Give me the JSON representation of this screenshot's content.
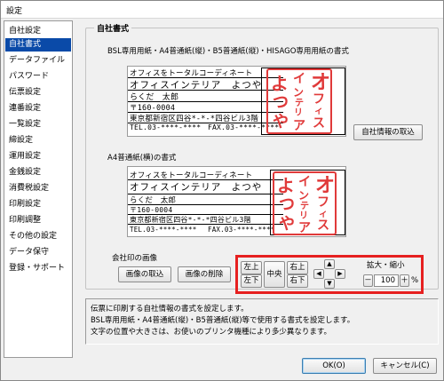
{
  "window": {
    "title": "設定"
  },
  "sidebar": {
    "items": [
      {
        "label": "自社設定"
      },
      {
        "label": "自社書式",
        "selected": true
      },
      {
        "label": "データファイル"
      },
      {
        "label": "パスワード"
      },
      {
        "label": "伝票設定"
      },
      {
        "label": "連番設定"
      },
      {
        "label": "一覧設定"
      },
      {
        "label": "締設定"
      },
      {
        "label": "運用設定"
      },
      {
        "label": "金銭設定"
      },
      {
        "label": "消費税設定"
      },
      {
        "label": "印刷設定"
      },
      {
        "label": "印刷調整"
      },
      {
        "label": "その他の設定"
      },
      {
        "label": "データ保守"
      },
      {
        "label": "登録・サポート"
      }
    ]
  },
  "main": {
    "group_title": "自社書式",
    "bsl_caption": "BSL専用用紙・A4普通紙(縦)・B5普通紙(縦)・HISAGO専用用紙の書式",
    "a4_caption": "A4普通紙(横)の書式",
    "stamp_caption": "会社印の画像",
    "company_lines": {
      "catchphrase": "オフィスをトータルコーディネート",
      "company_name": "オフィスインテリア　よつや",
      "person": "らくだ　太郎",
      "postal": "〒160-0004",
      "address": "東京都新宿区四谷*-*-*四谷ビル3階",
      "tel": "TEL.03-****-****",
      "fax": "FAX.03-****-****"
    },
    "stamp_chars": [
      "オ",
      "フ",
      "ィ",
      "ス",
      "イ",
      "ン",
      "テ",
      "リ",
      "ア",
      "よ",
      "つ",
      "や"
    ],
    "buttons": {
      "import_company": "自社情報の取込",
      "import_image": "画像の取込",
      "delete_image": "画像の削除"
    },
    "position": {
      "top_left": "左上",
      "bottom_left": "左下",
      "center": "中央",
      "top_right": "右上",
      "bottom_right": "右下",
      "arrow_up": "▲",
      "arrow_left": "◀",
      "arrow_right": "▶",
      "arrow_down": "▼"
    },
    "zoom": {
      "label": "拡大・縮小",
      "minus": "－",
      "plus": "＋",
      "value": "100",
      "unit": "%"
    },
    "info_lines": [
      "伝票に印刷する自社情報の書式を設定します。",
      "BSL専用用紙・A4普通紙(縦)・B5普通紙(縦)等で使用する書式を設定します。",
      "文字の位置や大きさは、お使いのプリンタ機種により多少異なります。"
    ]
  },
  "footer": {
    "ok": "OK(O)",
    "cancel": "キャンセル(C)"
  },
  "colors": {
    "selected_bg": "#0a4aa8",
    "stamp_red": "#e03a3a",
    "highlight_red": "#e62020"
  }
}
